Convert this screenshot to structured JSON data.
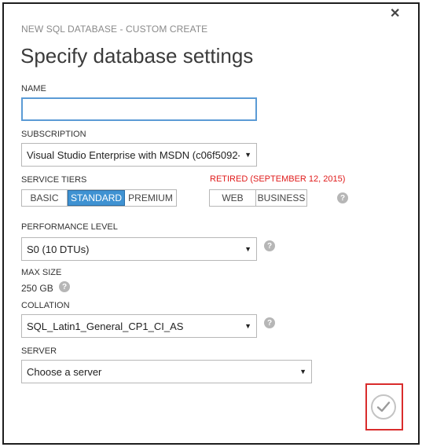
{
  "dialog": {
    "subtitle": "NEW SQL DATABASE - CUSTOM CREATE",
    "title": "Specify database settings",
    "close_glyph": "✕"
  },
  "name_field": {
    "label": "NAME",
    "value": "",
    "placeholder": ""
  },
  "subscription": {
    "label": "SUBSCRIPTION",
    "value": "Visual Studio Enterprise with MSDN (c06f5092-"
  },
  "service_tiers": {
    "label": "SERVICE TIERS",
    "options": [
      "BASIC",
      "STANDARD",
      "PREMIUM"
    ],
    "selected": "STANDARD",
    "retired_label": "RETIRED (SEPTEMBER 12, 2015)",
    "retired_options": [
      "WEB",
      "BUSINESS"
    ]
  },
  "performance_level": {
    "label": "PERFORMANCE LEVEL",
    "value": "S0 (10 DTUs)"
  },
  "max_size": {
    "label": "MAX SIZE",
    "value": "250 GB"
  },
  "collation": {
    "label": "COLLATION",
    "value": "SQL_Latin1_General_CP1_CI_AS"
  },
  "server": {
    "label": "SERVER",
    "value": "Choose a server"
  },
  "help_glyph": "?",
  "colors": {
    "accent": "#3f92d2",
    "retired": "#e01b1b",
    "highlight_box": "#d92c2c"
  }
}
